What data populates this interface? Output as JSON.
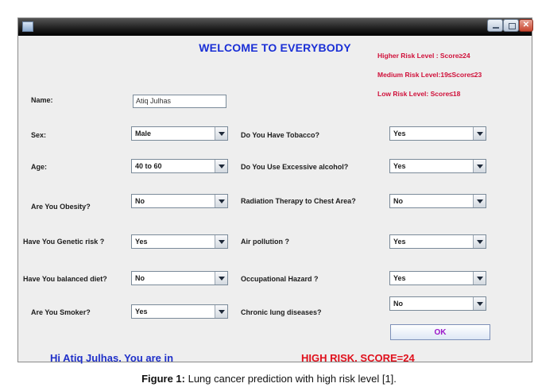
{
  "window": {
    "title": ""
  },
  "header": {
    "title": "WELCOME TO EVERYBODY"
  },
  "risk_levels": [
    "Higher Risk Level : Score≥24",
    "Medium Risk Level:19≤Score≤23",
    "Low Risk Level: Score≤18"
  ],
  "form": {
    "name_label": "Name:",
    "name_value": "Atiq Julhas",
    "left": [
      {
        "label": "Sex:",
        "value": "Male"
      },
      {
        "label": "Age:",
        "value": "40 to 60"
      },
      {
        "label": "Are You Obesity?",
        "value": "No"
      },
      {
        "label": "Have You Genetic risk ?",
        "value": "Yes"
      },
      {
        "label": "Have You balanced diet?",
        "value": "No"
      },
      {
        "label": "Are You Smoker?",
        "value": "Yes"
      }
    ],
    "right": [
      {
        "label": "Do You Have Tobacco?",
        "value": "Yes"
      },
      {
        "label": "Do You Use Excessive alcohol?",
        "value": "Yes"
      },
      {
        "label": "Radiation Therapy to Chest Area?",
        "value": "No"
      },
      {
        "label": "Air pollution ?",
        "value": "Yes"
      },
      {
        "label": "Occupational Hazard ?",
        "value": "Yes"
      },
      {
        "label": "Chronic lung diseases?",
        "value": "No"
      }
    ]
  },
  "ok_button": "OK",
  "result": {
    "greeting": "Hi Atiq Julhas. You are in",
    "status": "HIGH RISK.   SCORE=24"
  },
  "caption": {
    "figure_label": "Figure 1:",
    "text": " Lung cancer prediction with high risk level [1]."
  },
  "colors": {
    "title": "#1a2fd6",
    "risk_text": "#d0103a",
    "result_greeting": "#1f30c9",
    "result_status": "#e0101c",
    "ok_text": "#9b17c9"
  },
  "icons": [
    "app-icon",
    "minimize-icon",
    "maximize-icon",
    "close-icon",
    "dropdown-arrow-icon"
  ]
}
